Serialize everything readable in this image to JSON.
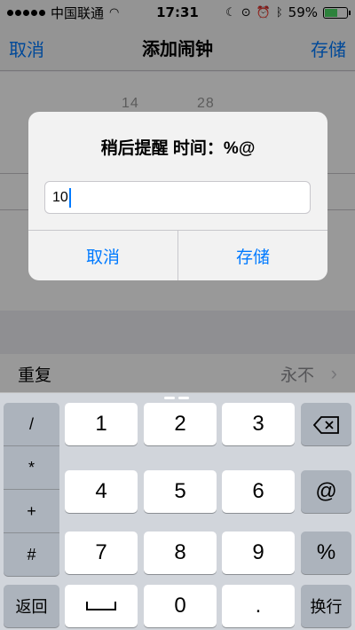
{
  "status_bar": {
    "carrier": "中国联通",
    "time": "17:31",
    "battery": "59%",
    "battery_level": 0.59
  },
  "nav": {
    "cancel": "取消",
    "title": "添加闹钟",
    "save": "存储"
  },
  "picker": {
    "top_hour": "14",
    "top_minute": "28"
  },
  "repeat": {
    "label": "重复",
    "value": "永不"
  },
  "alert": {
    "title": "稍后提醒 时间：%@",
    "input_value": "10",
    "cancel_label": "取消",
    "save_label": "存储"
  },
  "keyboard": {
    "left_keys": [
      "/",
      "*",
      "+",
      "#"
    ],
    "return_key": "返回",
    "digits": [
      "1",
      "2",
      "3",
      "4",
      "5",
      "6",
      "7",
      "8",
      "9",
      "0"
    ],
    "dot": ".",
    "at": "@",
    "percent": "%",
    "newline": "换行"
  },
  "colors": {
    "accent": "#007aff",
    "battery": "#4cd964"
  }
}
